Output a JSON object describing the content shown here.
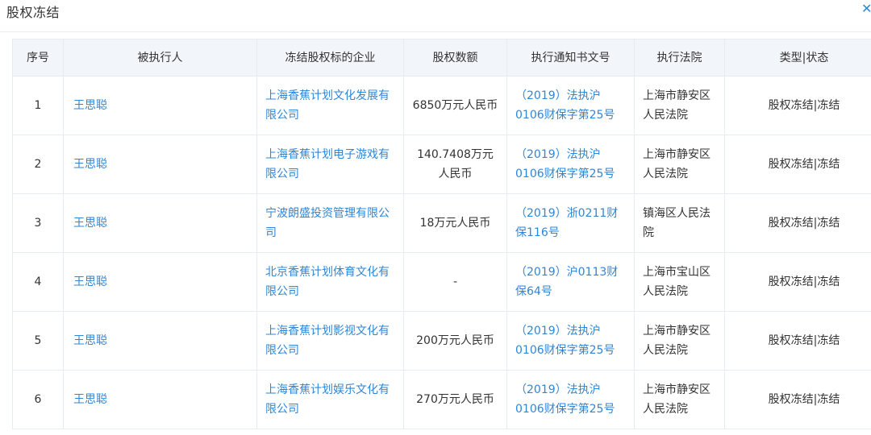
{
  "page_title": "股权冻结",
  "table": {
    "headers": [
      "序号",
      "被执行人",
      "冻结股权标的企业",
      "股权数额",
      "执行通知书文号",
      "执行法院",
      "类型|状态"
    ],
    "rows": [
      {
        "idx": "1",
        "name": "王思聪",
        "company": "上海香蕉计划文化发展有限公司",
        "amount": "6850万元人民币",
        "doc": "（2019）法执沪0106财保字第25号",
        "court": "上海市静安区人民法院",
        "status": "股权冻结|冻结"
      },
      {
        "idx": "2",
        "name": "王思聪",
        "company": "上海香蕉计划电子游戏有限公司",
        "amount": "140.7408万元人民币",
        "doc": "（2019）法执沪0106财保字第25号",
        "court": "上海市静安区人民法院",
        "status": "股权冻结|冻结"
      },
      {
        "idx": "3",
        "name": "王思聪",
        "company": "宁波朗盛投资管理有限公司",
        "amount": "18万元人民币",
        "doc": "（2019）浙0211财保116号",
        "court": "镇海区人民法院",
        "status": "股权冻结|冻结"
      },
      {
        "idx": "4",
        "name": "王思聪",
        "company": "北京香蕉计划体育文化有限公司",
        "amount": "-",
        "doc": "（2019）沪0113财保64号",
        "court": "上海市宝山区人民法院",
        "status": "股权冻结|冻结"
      },
      {
        "idx": "5",
        "name": "王思聪",
        "company": "上海香蕉计划影视文化有限公司",
        "amount": "200万元人民币",
        "doc": "（2019）法执沪0106财保字第25号",
        "court": "上海市静安区人民法院",
        "status": "股权冻结|冻结"
      },
      {
        "idx": "6",
        "name": "王思聪",
        "company": "上海香蕉计划娱乐文化有限公司",
        "amount": "270万元人民币",
        "doc": "（2019）法执沪0106财保字第25号",
        "court": "上海市静安区人民法院",
        "status": "股权冻结|冻结"
      }
    ]
  },
  "icons": {
    "close": "close-icon"
  },
  "colors": {
    "link": "#2f86d6",
    "header_bg": "#f2f6fa",
    "border": "#e7ecf1"
  }
}
